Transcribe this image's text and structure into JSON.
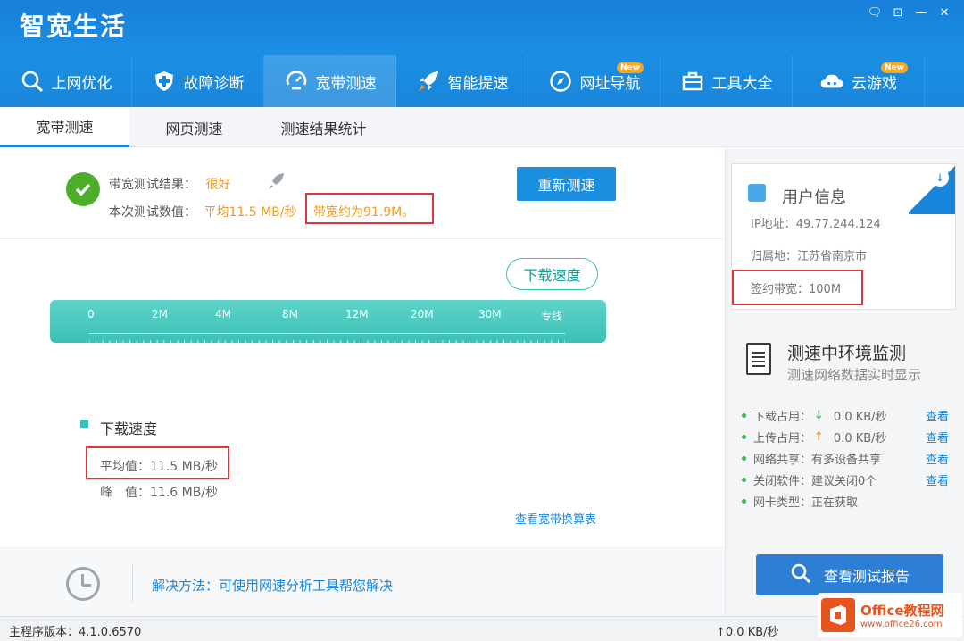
{
  "app": {
    "title": "智宽生活"
  },
  "window_controls": [
    "🗨",
    "⊡",
    "—",
    "✕"
  ],
  "nav": {
    "items": [
      {
        "label": "上网优化",
        "icon": "search-icon"
      },
      {
        "label": "故障诊断",
        "icon": "shield-plus-icon"
      },
      {
        "label": "宽带测速",
        "icon": "speed-dial-icon",
        "active": true
      },
      {
        "label": "智能提速",
        "icon": "rocket-icon"
      },
      {
        "label": "网址导航",
        "icon": "compass-icon",
        "badge": "New"
      },
      {
        "label": "工具大全",
        "icon": "toolbox-icon"
      },
      {
        "label": "云游戏",
        "icon": "cloud-game-icon",
        "badge": "New"
      }
    ]
  },
  "subtabs": [
    "宽带测速",
    "网页测速",
    "测速结果统计"
  ],
  "result": {
    "label_result": "带宽测试结果：",
    "value_result": "很好",
    "label_data": "本次测试数值：",
    "value_data": "平均11.5 MB/秒",
    "bandwidth_note": "带宽约为91.9M。",
    "retest_button": "重新测速"
  },
  "gauge": {
    "bubble_label": "下载速度",
    "ticks": [
      "0",
      "2M",
      "4M",
      "8M",
      "12M",
      "20M",
      "30M",
      "专线"
    ]
  },
  "download": {
    "title": "下载速度",
    "avg": "平均值：11.5 MB/秒",
    "peak": "峰　值：11.6 MB/秒",
    "link_table": "查看宽带换算表"
  },
  "tip": {
    "text": "解决方法：可使用网速分析工具帮您解决"
  },
  "user_info": {
    "title": "用户信息",
    "ip": "IP地址：49.77.244.124",
    "location": "归属地：江苏省南京市",
    "contract_bandwidth": "签约带宽：100M"
  },
  "monitor": {
    "title": "测速中环境监测",
    "subtitle": "测速网络数据实时显示",
    "rows": [
      {
        "label": "下载占用：",
        "arrow": "↓",
        "value": "0.0 KB/秒",
        "link": "查看"
      },
      {
        "label": "上传占用：",
        "arrow": "↑",
        "value": "0.0 KB/秒",
        "link": "查看"
      },
      {
        "label": "网络共享：有多设备共享",
        "link": "查看"
      },
      {
        "label": "关闭软件：建议关闭0个",
        "link": "查看"
      },
      {
        "label": "网卡类型：正在获取"
      }
    ],
    "report_button": "查看测试报告"
  },
  "status": {
    "version": "主程序版本：4.1.0.6570",
    "speed": "↑0.0 KB/秒"
  },
  "watermark": {
    "line1": "Office教程网",
    "line2": "www.office26.com"
  },
  "colors": {
    "primary": "#1a86db",
    "teal": "#3cc0b6",
    "orange": "#f39a1e",
    "highlight_red": "#d9373c"
  }
}
